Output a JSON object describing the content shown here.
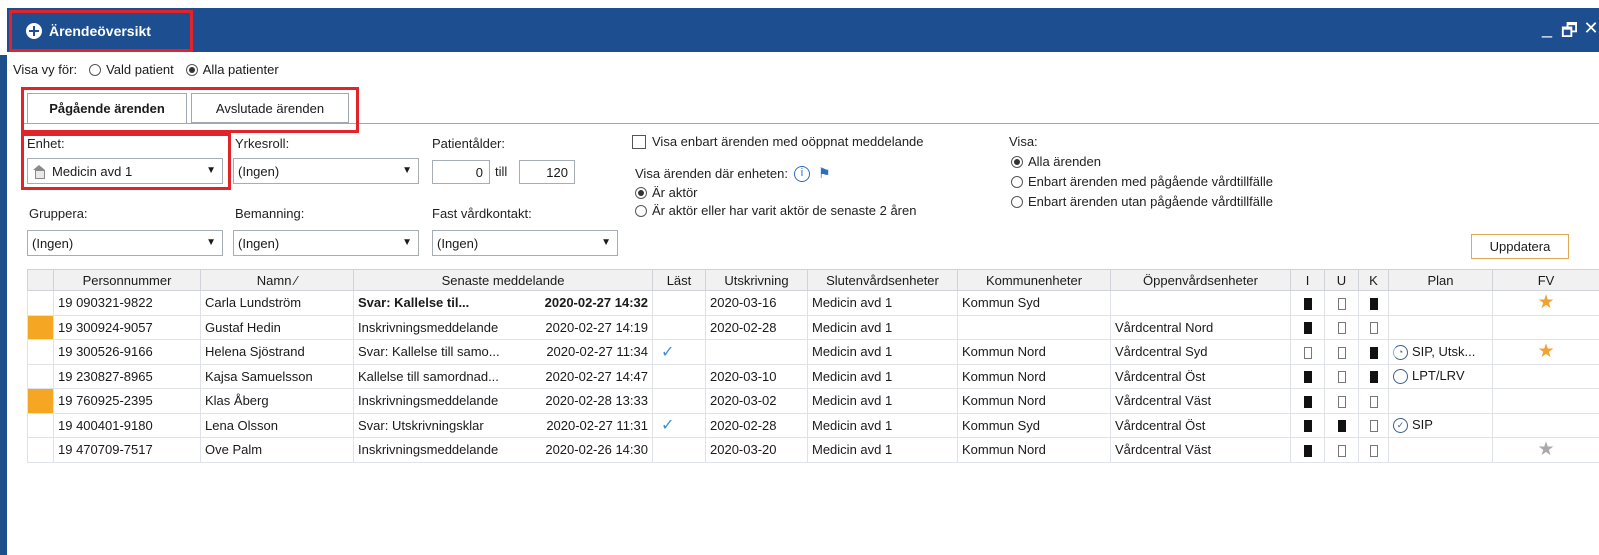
{
  "window": {
    "title": "Ärendeöversikt",
    "controls": [
      "_",
      "🗗",
      "✕"
    ]
  },
  "view_for": {
    "label": "Visa vy för:",
    "options": [
      {
        "label": "Vald patient",
        "selected": false
      },
      {
        "label": "Alla patienter",
        "selected": true
      }
    ]
  },
  "tabs": [
    {
      "label": "Pågående ärenden",
      "active": true
    },
    {
      "label": "Avslutade ärenden",
      "active": false
    }
  ],
  "filters": {
    "enhet_label": "Enhet:",
    "enhet_value": "Medicin avd 1",
    "yrkesroll_label": "Yrkesroll:",
    "yrkesroll_value": "(Ingen)",
    "age_label": "Patientålder:",
    "age_from": "0",
    "age_to_label": "till",
    "age_to": "120",
    "gruppera_label": "Gruppera:",
    "gruppera_value": "(Ingen)",
    "bemanning_label": "Bemanning:",
    "bemanning_value": "(Ingen)",
    "fast_label": "Fast vårdkontakt:",
    "fast_value": "(Ingen)",
    "unopened_label": "Visa enbart ärenden med oöppnat meddelande",
    "where_unit_label": "Visa ärenden där enheten:",
    "actor_now": "Är aktör",
    "actor_recent": "Är aktör eller har varit aktör de senaste 2 åren",
    "visa_label": "Visa:",
    "visa_all": "Alla ärenden",
    "visa_ongoing": "Enbart ärenden med pågående vårdtillfälle",
    "visa_without": "Enbart ärenden utan pågående vårdtillfälle",
    "update_button": "Uppdatera"
  },
  "table": {
    "headers": [
      "Personnummer",
      "Namn ⁄",
      "Senaste meddelande",
      "Läst",
      "Utskrivning",
      "Slutenvårdsenheter",
      "Kommunenheter",
      "Öppenvårdsenheter",
      "I",
      "U",
      "K",
      "Plan",
      "FV"
    ],
    "rows": [
      {
        "flag": false,
        "bold": true,
        "pnr": "19 090321-9822",
        "name": "Carla Lundström",
        "msg": "Svar: Kallelse til...",
        "msg_time": "2020-02-27 14:32",
        "read": false,
        "utskr": "2020-03-16",
        "sluten": "Medicin avd 1",
        "kommun": "Kommun Syd",
        "oppen": "",
        "i": true,
        "u": false,
        "k": true,
        "plan": "",
        "plan_icon": "",
        "fv": "gold"
      },
      {
        "flag": true,
        "bold": false,
        "pnr": "19 300924-9057",
        "name": "Gustaf Hedin",
        "msg": "Inskrivningsmeddelande",
        "msg_time": "2020-02-27 14:19",
        "read": false,
        "utskr": "2020-02-28",
        "sluten": "Medicin avd 1",
        "kommun": "",
        "oppen": "Vårdcentral Nord",
        "i": true,
        "u": false,
        "k": false,
        "plan": "",
        "plan_icon": "",
        "fv": ""
      },
      {
        "flag": false,
        "bold": false,
        "pnr": "19 300526-9166",
        "name": "Helena Sjöstrand",
        "msg": "Svar: Kallelse till samo...",
        "msg_time": "2020-02-27 11:34",
        "read": true,
        "utskr": "",
        "sluten": "Medicin avd 1",
        "kommun": "Kommun Nord",
        "oppen": "Vårdcentral Syd",
        "i": false,
        "u": false,
        "k": true,
        "plan": "SIP, Utsk...",
        "plan_icon": "partial",
        "fv": "gold"
      },
      {
        "flag": false,
        "bold": false,
        "pnr": "19 230827-8965",
        "name": "Kajsa Samuelsson",
        "msg": "Kallelse till samordnad...",
        "msg_time": "2020-02-27 14:47",
        "read": false,
        "utskr": "2020-03-10",
        "sluten": "Medicin avd 1",
        "kommun": "Kommun Nord",
        "oppen": "Vårdcentral Öst",
        "i": true,
        "u": false,
        "k": true,
        "plan": "LPT/LRV",
        "plan_icon": "empty",
        "fv": ""
      },
      {
        "flag": true,
        "bold": false,
        "pnr": "19 760925-2395",
        "name": "Klas Åberg",
        "msg": "Inskrivningsmeddelande",
        "msg_time": "2020-02-28 13:33",
        "read": false,
        "utskr": "2020-03-02",
        "sluten": "Medicin avd 1",
        "kommun": "Kommun Nord",
        "oppen": "Vårdcentral Väst",
        "i": true,
        "u": false,
        "k": false,
        "plan": "",
        "plan_icon": "",
        "fv": ""
      },
      {
        "flag": false,
        "bold": false,
        "pnr": "19 400401-9180",
        "name": "Lena Olsson",
        "msg": "Svar: Utskrivningsklar",
        "msg_time": "2020-02-27 11:31",
        "read": true,
        "utskr": "2020-02-28",
        "sluten": "Medicin avd 1",
        "kommun": "Kommun Syd",
        "oppen": "Vårdcentral Öst",
        "i": true,
        "u": true,
        "k": false,
        "plan": "SIP",
        "plan_icon": "check",
        "fv": ""
      },
      {
        "flag": false,
        "bold": false,
        "pnr": "19 470709-7517",
        "name": "Ove Palm",
        "msg": "Inskrivningsmeddelande",
        "msg_time": "2020-02-26 14:30",
        "read": false,
        "utskr": "2020-03-20",
        "sluten": "Medicin avd 1",
        "kommun": "Kommun Nord",
        "oppen": "Vårdcentral Väst",
        "i": true,
        "u": false,
        "k": false,
        "plan": "",
        "plan_icon": "",
        "fv": "grey"
      }
    ]
  }
}
